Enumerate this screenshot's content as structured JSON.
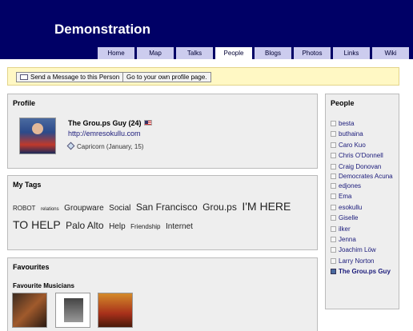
{
  "site": {
    "title": "Demonstration"
  },
  "nav": {
    "tabs": [
      {
        "label": "Home",
        "active": false
      },
      {
        "label": "Map",
        "active": false
      },
      {
        "label": "Talks",
        "active": false
      },
      {
        "label": "People",
        "active": true
      },
      {
        "label": "Blogs",
        "active": false
      },
      {
        "label": "Photos",
        "active": false
      },
      {
        "label": "Links",
        "active": false
      },
      {
        "label": "Wiki",
        "active": false
      }
    ]
  },
  "actions": {
    "message_label": "Send a Message to this Person",
    "own_profile_label": "Go to your own profile page."
  },
  "profile": {
    "heading": "Profile",
    "name": "The Grou.ps Guy (24)",
    "url": "http://emresokullu.com",
    "zodiac": "Capricorn (January, 15)"
  },
  "tags": {
    "heading": "My Tags",
    "items": [
      {
        "text": "ROBOT",
        "size": "s"
      },
      {
        "text": "relations",
        "size": "xs"
      },
      {
        "text": "Groupware",
        "size": "m"
      },
      {
        "text": "Social",
        "size": "m"
      },
      {
        "text": "San Francisco",
        "size": "l"
      },
      {
        "text": "Grou.ps",
        "size": "l"
      },
      {
        "text": "I'M HERE TO HELP",
        "size": "xl"
      },
      {
        "text": "Palo Alto",
        "size": "l"
      },
      {
        "text": "Help",
        "size": "m"
      },
      {
        "text": "Friendship",
        "size": "s"
      },
      {
        "text": "Internet",
        "size": "m"
      }
    ]
  },
  "favourites": {
    "heading": "Favourites",
    "musicians_heading": "Favourite Musicians"
  },
  "people": {
    "heading": "People",
    "members": [
      "besta",
      "buthaina",
      "Caro Kuo",
      "Chris O'Donnell",
      "Craig Donovan",
      "Democrates Acuna",
      "edjones",
      "Ema",
      "esokullu",
      "Giselle",
      "ilker",
      "Jenna",
      "Joachim Löw",
      "Larry Norton"
    ],
    "current_member": "The Grou.ps Guy"
  }
}
